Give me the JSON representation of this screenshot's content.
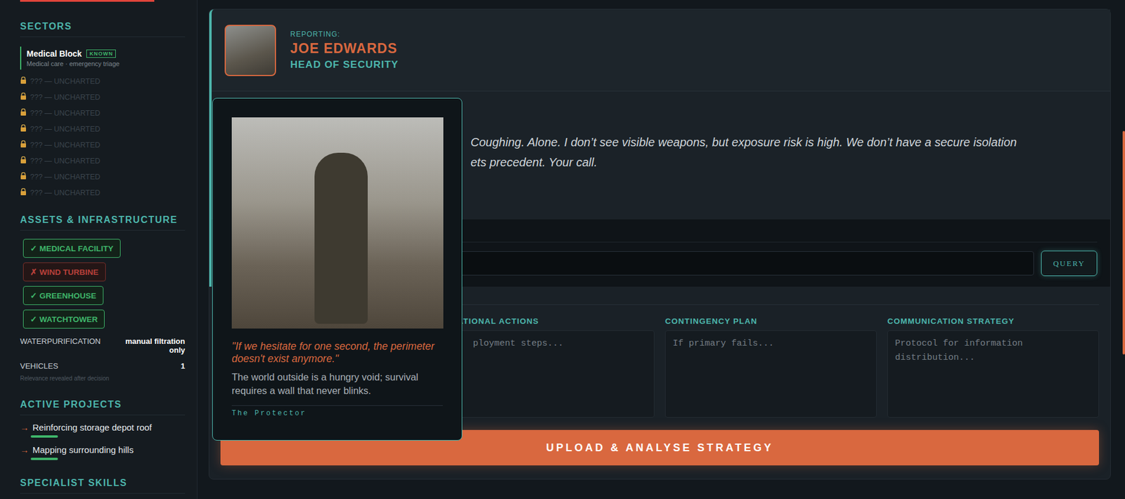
{
  "sidebar": {
    "sectors_title": "SECTORS",
    "sectors": [
      {
        "name": "Medical Block",
        "badge": "KNOWN",
        "subtitle": "Medical care · emergency triage",
        "locked": false
      },
      {
        "name": "??? — UNCHARTED",
        "locked": true
      },
      {
        "name": "??? — UNCHARTED",
        "locked": true
      },
      {
        "name": "??? — UNCHARTED",
        "locked": true
      },
      {
        "name": "??? — UNCHARTED",
        "locked": true
      },
      {
        "name": "??? — UNCHARTED",
        "locked": true
      },
      {
        "name": "??? — UNCHARTED",
        "locked": true
      },
      {
        "name": "??? — UNCHARTED",
        "locked": true
      },
      {
        "name": "??? — UNCHARTED",
        "locked": true
      }
    ],
    "assets_title": "ASSETS & INFRASTRUCTURE",
    "assets": [
      {
        "label": "✓ MEDICAL FACILITY",
        "available": true
      },
      {
        "label": "✗ WIND TURBINE",
        "available": false
      },
      {
        "label": "✓ GREENHOUSE",
        "available": true
      },
      {
        "label": "✓ WATCHTOWER",
        "available": true
      }
    ],
    "stats": [
      {
        "label": "WATERPURIFICATION",
        "value": "manual filtration only"
      },
      {
        "label": "VEHICLES",
        "value": "1"
      }
    ],
    "stats_note": "Relevance revealed after decision",
    "projects_title": "ACTIVE PROJECTS",
    "projects": [
      {
        "icon": "→",
        "name": "Reinforcing storage depot roof",
        "level": 0.18
      },
      {
        "icon": "→",
        "name": "Mapping surrounding hills",
        "level": 0.18
      }
    ],
    "skills_title": "SPECIALIST SKILLS"
  },
  "report": {
    "label": "REPORTING:",
    "name": "JOE EDWARDS",
    "role": "HEAD OF SECURITY",
    "message_lines": [
      "Coughing. Alone. I don’t see visible weapons, but exposure risk is high. We don’t have a secure isolation",
      "ets precedent. Your call."
    ]
  },
  "query": {
    "button": "QUERY"
  },
  "plan_fields": [
    {
      "label": "RATIONAL ACTIONS",
      "placeholder": "ployment steps..."
    },
    {
      "label": "CONTINGENCY PLAN",
      "placeholder": "If primary fails..."
    },
    {
      "label": "COMMUNICATION STRATEGY",
      "placeholder": "Protocol for information distribution..."
    }
  ],
  "submit": "UPLOAD & ANALYSE STRATEGY",
  "tooltip": {
    "quote": "\"If we hesitate for one second, the perimeter doesn't exist anymore.\"",
    "description": "The world outside is a hungry void; survival requires a wall that never blinks.",
    "archetype": "The Protector"
  }
}
